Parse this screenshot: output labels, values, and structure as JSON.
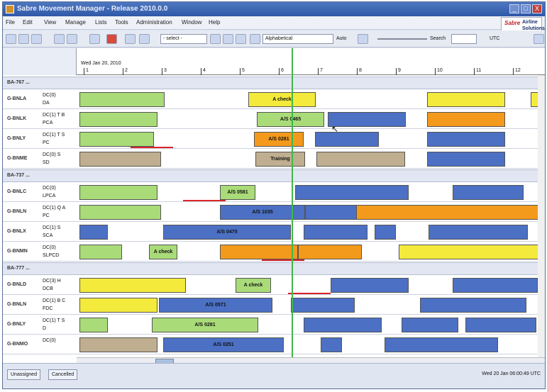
{
  "window": {
    "title": "Sabre Movement Manager - Release 2010.0.0",
    "min": "_",
    "max": "□",
    "close": "X"
  },
  "menu": [
    "File",
    "Edit",
    "View",
    "Manage",
    "Lists",
    "Tools",
    "Administration",
    "Window",
    "Help"
  ],
  "brand": {
    "sabre": "Sabre",
    "a1": "Airline",
    "a2": "Solutions"
  },
  "toolbar": {
    "select": "- select -",
    "sort": "Alphabetical",
    "auto_label": "Auto",
    "search_label": "Search",
    "utc_label": "UTC"
  },
  "timeline": {
    "date": "Wed Jan 20, 2010",
    "ticks": [
      "1",
      "2",
      "3",
      "4",
      "5",
      "6",
      "7",
      "8",
      "9",
      "10",
      "11",
      "12"
    ]
  },
  "groups": [
    "BA-767 ...",
    "BA-737 ...",
    "BA-777 ..."
  ],
  "rows": [
    {
      "reg": "G-BNLA",
      "l1": "DC(0)",
      "l2": "DA",
      "bars": [
        {
          "c": "yellow",
          "t": "A check"
        }
      ]
    },
    {
      "reg": "G-BNLK",
      "l1": "DC(1) T B",
      "l2": "PCA",
      "bars": [
        {
          "c": "orange",
          "t": "A/S 0465"
        }
      ]
    },
    {
      "reg": "G-BNLY",
      "l1": "DC(1) T S",
      "l2": "PC",
      "bars": [
        {
          "c": "blue",
          "t": "A/S 0281"
        }
      ]
    },
    {
      "reg": "G-BNME",
      "l1": "DC(0) S",
      "l2": "SD",
      "bars": [
        {
          "c": "gray",
          "t": "Training"
        }
      ]
    },
    {
      "reg": "G-BNLC",
      "l1": "DC(0)",
      "l2": "LPCA",
      "bars": [
        {
          "c": "blue",
          "t": "A/S 0581"
        }
      ]
    },
    {
      "reg": "G-BNLN",
      "l1": "DC(1) Q A",
      "l2": "PC",
      "bars": [
        {
          "c": "orange",
          "t": "A/S 1035"
        }
      ]
    },
    {
      "reg": "G-BNLX",
      "l1": "DC(1) S",
      "l2": "SCA",
      "bars": [
        {
          "c": "blue",
          "t": "A/S 0475"
        }
      ]
    },
    {
      "reg": "G-BNMN",
      "l1": "DC(0)",
      "l2": "SLPCD",
      "bars": [
        {
          "c": "yellow",
          "t": "A check"
        }
      ]
    },
    {
      "reg": "G-BNLD",
      "l1": "DC(3) H",
      "l2": "DCB",
      "bars": [
        {
          "c": "yellow",
          "t": "A check"
        }
      ]
    },
    {
      "reg": "G-BNLN",
      "l1": "DC(1) B C",
      "l2": "FDC",
      "bars": [
        {
          "c": "blue",
          "t": "A/S 0571"
        }
      ]
    },
    {
      "reg": "G-BNLY",
      "l1": "DC(1) T S",
      "l2": "D",
      "bars": [
        {
          "c": "green",
          "t": "A/S 0281"
        }
      ]
    },
    {
      "reg": "G-BNMO",
      "l1": "DC(0)",
      "l2": "",
      "bars": [
        {
          "c": "blue",
          "t": "A/S 0251"
        }
      ]
    }
  ],
  "status": {
    "unassigned": "Unassigned",
    "cancelled": "Cancelled",
    "clock": "Wed 20 Jan 06:00:49 UTC"
  }
}
